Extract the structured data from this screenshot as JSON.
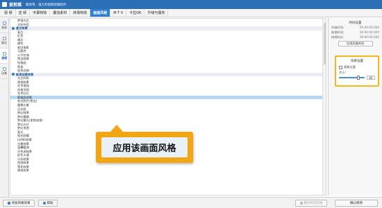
{
  "window": {
    "app_name": "爱剪辑",
    "tagline": "最易用、强大的视频剪辑软件"
  },
  "tabs": [
    {
      "label": "视 频"
    },
    {
      "label": "音 频"
    },
    {
      "label": "字幕特效"
    },
    {
      "label": "叠加素材"
    },
    {
      "label": "转场特效"
    },
    {
      "label": "画面风格",
      "active": true
    },
    {
      "label": "M T V"
    },
    {
      "label": "卡拉OK"
    },
    {
      "label": "升级与服务"
    }
  ],
  "sidebar": {
    "items": [
      {
        "label": "画面"
      },
      {
        "label": "美化"
      },
      {
        "label": "滤镜",
        "active": true
      },
      {
        "label": "动景"
      }
    ]
  },
  "effects_list": {
    "rows": [
      {
        "label": "梦境光芒",
        "type": "item"
      },
      {
        "label": "光彩夺目",
        "type": "item"
      },
      {
        "label": "复古效果",
        "type": "group"
      },
      {
        "label": "复古",
        "type": "item"
      },
      {
        "label": "反色",
        "type": "item"
      },
      {
        "label": "褐光",
        "type": "item"
      },
      {
        "label": "褐色",
        "type": "item"
      },
      {
        "label": "老旧电影",
        "type": "item"
      },
      {
        "label": "马赛克",
        "type": "item"
      },
      {
        "label": "十字拉伸",
        "type": "item"
      },
      {
        "label": "黑白效果",
        "type": "item"
      },
      {
        "label": "铅笔画",
        "type": "item"
      },
      {
        "label": "黄昏",
        "type": "item"
      },
      {
        "label": "加亮边缘",
        "type": "item"
      },
      {
        "label": "新奇创意效果",
        "type": "group"
      },
      {
        "label": "光芒四射",
        "type": "item"
      },
      {
        "label": "透视效果",
        "type": "item"
      },
      {
        "label": "艺术潮流",
        "type": "item"
      },
      {
        "label": "创意涂鸦",
        "type": "item"
      },
      {
        "label": "艺术幻灯",
        "type": "item"
      },
      {
        "label": "素描画效果",
        "type": "item",
        "selected": true
      },
      {
        "label": "老式照片(黑白)",
        "type": "item"
      },
      {
        "label": "晨雾光晕",
        "type": "item"
      },
      {
        "label": "月光照",
        "type": "item"
      },
      {
        "label": "梦幻效果",
        "type": "item"
      },
      {
        "label": "梦幻模糊",
        "type": "item"
      },
      {
        "label": "梦幻模光(柔焦效果)",
        "type": "item"
      },
      {
        "label": "梦幻光芒",
        "type": "item"
      },
      {
        "label": "梦幻泡泡",
        "type": "item"
      },
      {
        "label": "柔光",
        "type": "item"
      },
      {
        "label": "阳光照耀",
        "type": "item"
      },
      {
        "label": "LOMO效果",
        "type": "item"
      },
      {
        "label": "光晕效果",
        "type": "item"
      },
      {
        "label": "温馨暖调",
        "type": "item"
      },
      {
        "label": "冷色调效果",
        "type": "item"
      },
      {
        "label": "彩色卡通",
        "type": "item"
      },
      {
        "label": "闪烁效果",
        "type": "item"
      },
      {
        "label": "泡泡效果",
        "type": "item"
      },
      {
        "label": "雪花效果",
        "type": "item"
      },
      {
        "label": "燃烧效果",
        "type": "item"
      }
    ]
  },
  "right_panel": {
    "time_title": "时间设置",
    "start_label": "开始时间：",
    "start_value": "00:00:00.000",
    "end_label": "结束时间：",
    "end_value": "00:00:00.000",
    "duration_label": "持续时长：",
    "duration_value": "00:00:00.000",
    "apply_time_button": "应用风格时间",
    "effect_title": "效果设置",
    "checkbox_label": "柔和过渡",
    "size_label": "大小：",
    "size_value": "80",
    "size_level_percent": 75
  },
  "bottom": {
    "add_style_button": "添加风格效果",
    "help_button": "帮助",
    "delete_button": "删除所选风格",
    "confirm_button": "确认修改"
  },
  "callout": {
    "text": "应用该画面风格"
  },
  "colors": {
    "title_bar": "#2b6fb6",
    "active_tab": "#2e7fd2",
    "callout": "#f2a616",
    "highlight_box": "#f5b81b",
    "selected_row": "#b8d7f3"
  }
}
